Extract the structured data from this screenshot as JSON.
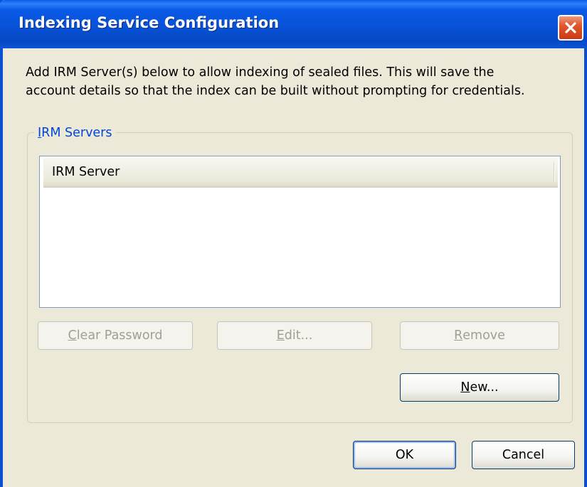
{
  "window": {
    "title": "Indexing Service Configuration"
  },
  "intro": {
    "line1": "Add IRM Server(s) below to allow indexing of sealed files.  This will save the",
    "line2": "account details so that the index can be built without prompting for credentials."
  },
  "group": {
    "legend_mnemonic": "I",
    "legend_rest": "RM Servers"
  },
  "list": {
    "columns": [
      "IRM Server"
    ],
    "rows": []
  },
  "buttons": {
    "clear_password": {
      "mnemonic": "C",
      "rest": "lear Password",
      "enabled": false
    },
    "edit": {
      "mnemonic": "E",
      "rest": "dit...",
      "enabled": false
    },
    "remove": {
      "mnemonic": "R",
      "rest": "emove",
      "enabled": false
    },
    "new": {
      "mnemonic": "N",
      "rest": "ew...",
      "enabled": true
    },
    "ok": {
      "label": "OK",
      "enabled": true,
      "default": true
    },
    "cancel": {
      "label": "Cancel",
      "enabled": true
    }
  },
  "colors": {
    "titlebar": "#0752d8",
    "dialog_bg": "#ece9d8",
    "group_label": "#0046d5",
    "close_button": "#e0572e"
  }
}
